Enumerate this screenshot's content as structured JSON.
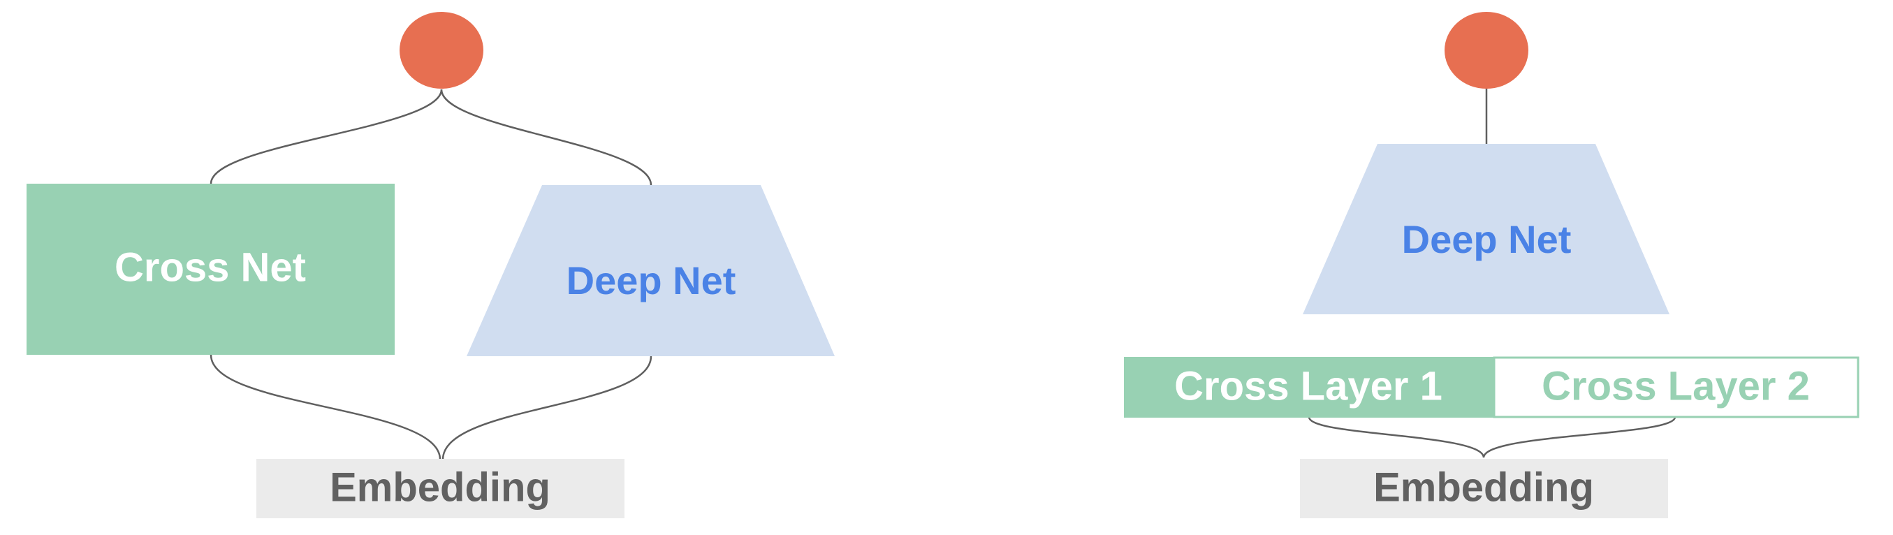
{
  "colors": {
    "output_node": "#e76f51",
    "cross_fill": "#98d1b3",
    "deep_fill": "#d0ddf0",
    "deep_text": "#4a82e6",
    "embedding_fill": "#ebebeb",
    "embedding_text": "#616161",
    "wire": "#5f5f5f",
    "white_text": "#ffffff"
  },
  "left_diagram": {
    "cross_net_label": "Cross Net",
    "deep_net_label": "Deep Net",
    "embedding_label": "Embedding"
  },
  "right_diagram": {
    "deep_net_label": "Deep Net",
    "cross_layer_1_label": "Cross Layer 1",
    "cross_layer_2_label": "Cross Layer 2",
    "embedding_label": "Embedding"
  }
}
